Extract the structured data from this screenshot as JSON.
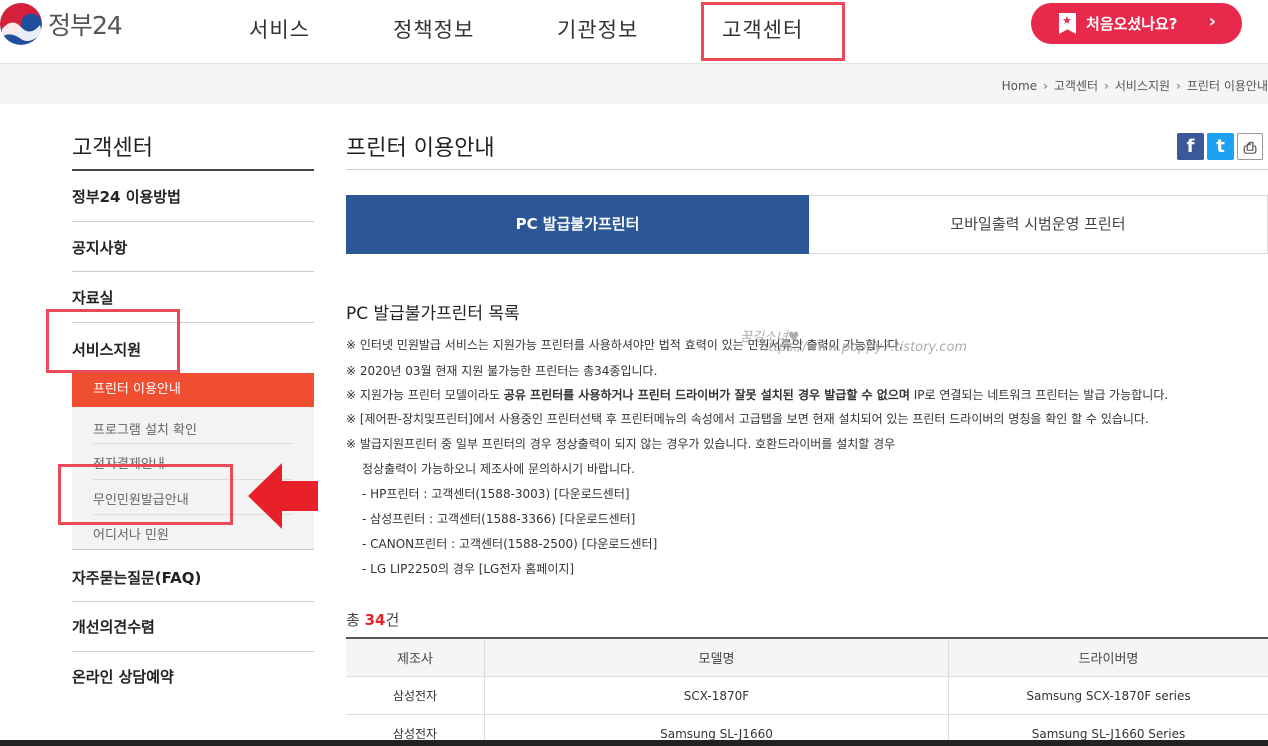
{
  "header": {
    "logo_text": "정부24",
    "nav": [
      "서비스",
      "정책정보",
      "기관정보",
      "고객센터"
    ],
    "cta_label": "처음오셨나요?",
    "cta_arrow": "›"
  },
  "breadcrumb": [
    "Home",
    "고객센터",
    "서비스지원",
    "프린터 이용안내"
  ],
  "sidebar": {
    "title": "고객센터",
    "items": [
      "정부24 이용방법",
      "공지사항",
      "자료실",
      "서비스지원",
      "자주묻는질문(FAQ)",
      "개선의견수렴",
      "온라인 상담예약"
    ],
    "sub_items": [
      "프린터 이용안내",
      "프로그램 설치 확인",
      "전자결제안내",
      "무인민원발급안내",
      "어디서나 민원"
    ]
  },
  "main": {
    "title": "프린터 이용안내",
    "share": {
      "facebook": "f",
      "twitter": "t",
      "print": "⎙"
    },
    "tabs": [
      "PC 발급불가프린터",
      "모바일출력 시범운영 프린터"
    ],
    "section_title": "PC 발급불가프린터 목록",
    "watermark": [
      "꿈길소녀♥",
      "https://www.poppy7.tistory.com"
    ],
    "notes": {
      "n1": "※ 인터넷 민원발급 서비스는 지원가능 프린터를 사용하셔야만 법적 효력이 있는 민원서류의 출력이 가능합니다.",
      "n2": "※ 2020년 03월 현재 지원 불가능한 프린터는 총34종입니다.",
      "n3_a": "※ 지원가능 프린터 모델이라도 ",
      "n3_b": "공유 프린터를 사용하거나 프린터 드라이버가 잘못 설치된 경우 발급할 수 없으며",
      "n3_c": " IP로 연결되는 네트워크 프린터는 발급 가능합니다.",
      "n4": "※ [제어판-장치및프린터]에서 사용중인 프린터선택 후 프린터메뉴의 속성에서 고급탭을 보면 현재 설치되어 있는 프린터 드라이버의 명칭을 확인 할 수 있습니다.",
      "n5": "※ 발급지원프린터 중 일부 프린터의 경우 정상출력이 되지 않는 경우가 있습니다. 호환드라이버를 설치할 경우",
      "n5b": "정상출력이 가능하오니 제조사에 문의하시기 바랍니다.",
      "l1": "- HP프린터 : 고객센터(1588-3003) [다운로드센터]",
      "l2": "- 삼성프린터 : 고객센터(1588-3366) [다운로드센터]",
      "l3": "- CANON프린터 : 고객센터(1588-2500) [다운로드센터]",
      "l4": "- LG LIP2250의 경우 [LG전자 홈페이지]"
    },
    "total_prefix": "총 ",
    "total_count": "34",
    "total_suffix": "건",
    "table": {
      "headers": [
        "제조사",
        "모델명",
        "드라이버명"
      ],
      "rows": [
        [
          "삼성전자",
          "SCX-1870F",
          "Samsung SCX-1870F series"
        ],
        [
          "삼성전자",
          "Samsung SL-J1660",
          "Samsung SL-J1660 Series"
        ]
      ]
    }
  },
  "colors": {
    "accent_red": "#e8294c",
    "active_orange": "#f04e30",
    "tab_blue": "#2b5797",
    "annotation_red": "#ea4a55"
  }
}
